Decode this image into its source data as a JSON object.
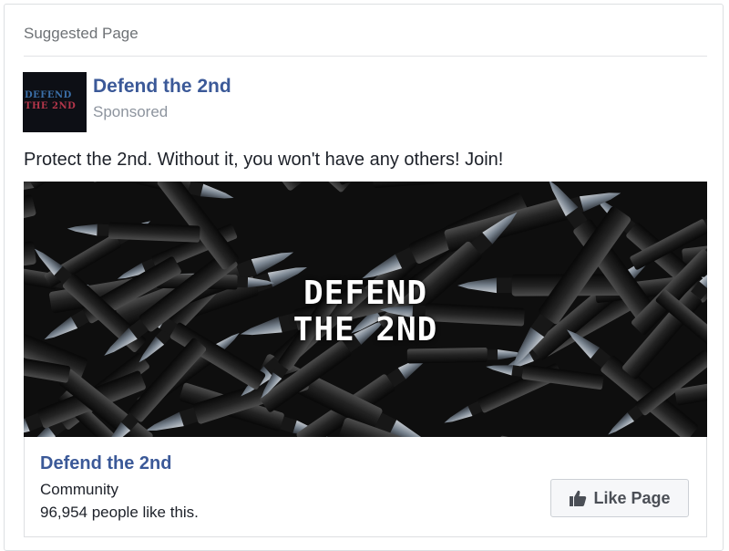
{
  "header": {
    "label": "Suggested Page"
  },
  "page": {
    "name": "Defend the 2nd",
    "sponsored_label": "Sponsored",
    "avatar_text_line1": "DEFEND",
    "avatar_text_line2": "THE 2ND"
  },
  "post": {
    "text": "Protect the 2nd. Without it, you won't have any others! Join!"
  },
  "hero": {
    "title_line1": "DEFEND",
    "title_line2": "THE 2ND"
  },
  "footer": {
    "page_name": "Defend the 2nd",
    "category": "Community",
    "likes": "96,954 people like this.",
    "like_button_label": "Like Page",
    "like_button_icon": "thumbs-up-icon"
  },
  "colors": {
    "link_blue": "#3b5998",
    "muted_gray": "#8d949e",
    "button_bg": "#f6f7f9",
    "border": "#dddfe2"
  }
}
